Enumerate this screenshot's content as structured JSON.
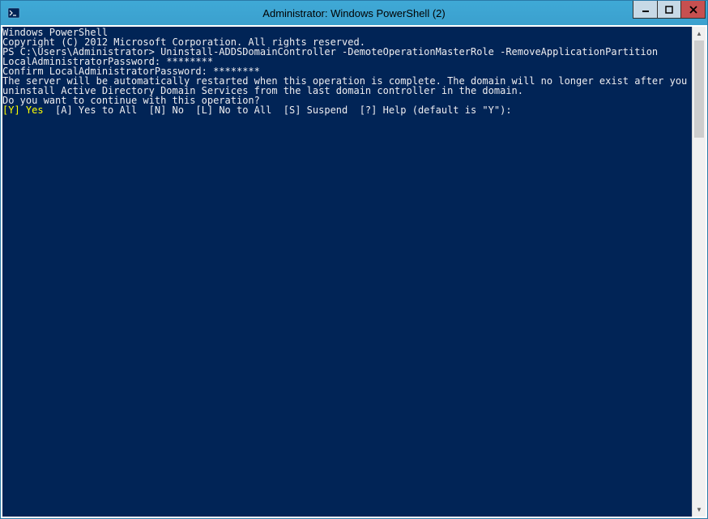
{
  "titlebar": {
    "title": "Administrator: Windows PowerShell (2)"
  },
  "console": {
    "l1": "Windows PowerShell",
    "l2": "Copyright (C) 2012 Microsoft Corporation. All rights reserved.",
    "l3": "",
    "l4": "PS C:\\Users\\Administrator> Uninstall-ADDSDomainController -DemoteOperationMasterRole -RemoveApplicationPartition",
    "l5": "LocalAdministratorPassword: ********",
    "l6": "Confirm LocalAdministratorPassword: ********",
    "l7": "",
    "l8": "The server will be automatically restarted when this operation is complete. The domain will no longer exist after you",
    "l9": "uninstall Active Directory Domain Services from the last domain controller in the domain.",
    "l10": "Do you want to continue with this operation?",
    "l11_yellow": "[Y] Yes",
    "l11_rest": "  [A] Yes to All  [N] No  [L] No to All  [S] Suspend  [?] Help (default is \"Y\"):"
  }
}
